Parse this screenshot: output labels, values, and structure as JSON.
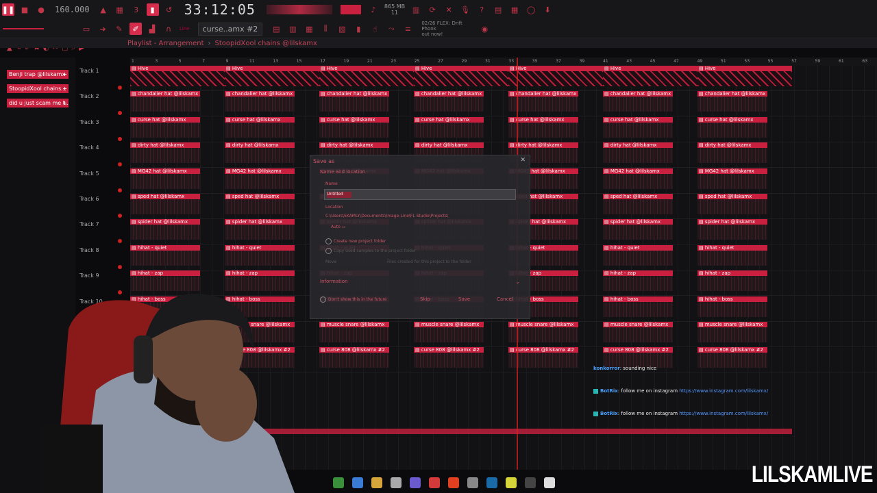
{
  "toolbar": {
    "tempo": "160.000",
    "time": "33:12:05",
    "pattern": "curse..amx #2",
    "news_title": "02/26 FLEX: Drift Phonk",
    "news_sub": "out now!",
    "cpu_top": "865 MB",
    "cpu_bottom": "11"
  },
  "playlist": {
    "title_prefix": "Playlist - Arrangement",
    "project": "StoopidXool chains @lilskamx"
  },
  "patterns": [
    "Benji trap @lilskamx",
    "StoopidXool chains...",
    "did u just scam me t..."
  ],
  "ruler": [
    "1",
    "3",
    "5",
    "7",
    "9",
    "11",
    "13",
    "15",
    "17",
    "19",
    "21",
    "23",
    "25",
    "27",
    "29",
    "31",
    "33",
    "35",
    "37",
    "39",
    "41",
    "43",
    "45",
    "47",
    "49",
    "51",
    "53",
    "55",
    "57",
    "59",
    "61",
    "63"
  ],
  "tracks": [
    {
      "label": "Track 1",
      "clip": "Hive"
    },
    {
      "label": "Track 2",
      "clip": "chandalier hat @lilskamx"
    },
    {
      "label": "Track 3",
      "clip": "curse hat @lilskamx"
    },
    {
      "label": "Track 4",
      "clip": "dirty hat @lilskamx"
    },
    {
      "label": "Track 5",
      "clip": "MG42 hat @lilskamx"
    },
    {
      "label": "Track 6",
      "clip": "sped hat @lilskamx"
    },
    {
      "label": "Track 7",
      "clip": "spider hat @lilskamx"
    },
    {
      "label": "Track 8",
      "clip": "hihat - quiet"
    },
    {
      "label": "Track 9",
      "clip": "hihat - zap"
    },
    {
      "label": "Track 10",
      "clip": "hihat - boss"
    },
    {
      "label": "Track 11",
      "clip": "muscle snare @lilskamx"
    },
    {
      "label": "Tr",
      "clip": "curse 808 @lilskamx #2"
    }
  ],
  "dialog": {
    "title": "Save as",
    "section": "Name and location",
    "name_label": "Name",
    "name_value": "Untitled",
    "location_label": "Location",
    "location_path": "C:\\Users\\SKAMLY\\Documents\\Image-Line\\FL Studio\\Projects\\",
    "auto": "Auto",
    "create_folder": "Create new project folder",
    "copy_samples": "Copy used samples to the project folder",
    "move_label": "Move",
    "move_desc": "Files created for this project to the folder",
    "information": "Information",
    "dont_show": "Don't show this in the future",
    "skip": "Skip",
    "save": "Save",
    "cancel": "Cancel"
  },
  "chat": [
    {
      "user": "konkorror",
      "msg": ": sounding nice",
      "style": "b"
    },
    {
      "user": "BotRix",
      "msg": ": follow me on instagram",
      "link": "https://www.instagram.com/lilskamx/",
      "style": "b"
    },
    {
      "user": "BotRix",
      "msg": ": follow me on instagram",
      "link": "https://www.instagram.com/lilskamx/",
      "style": "b"
    }
  ],
  "brand": "LILSKAMLIVE",
  "colors": {
    "accent": "#c8203e",
    "bg": "#121215"
  }
}
